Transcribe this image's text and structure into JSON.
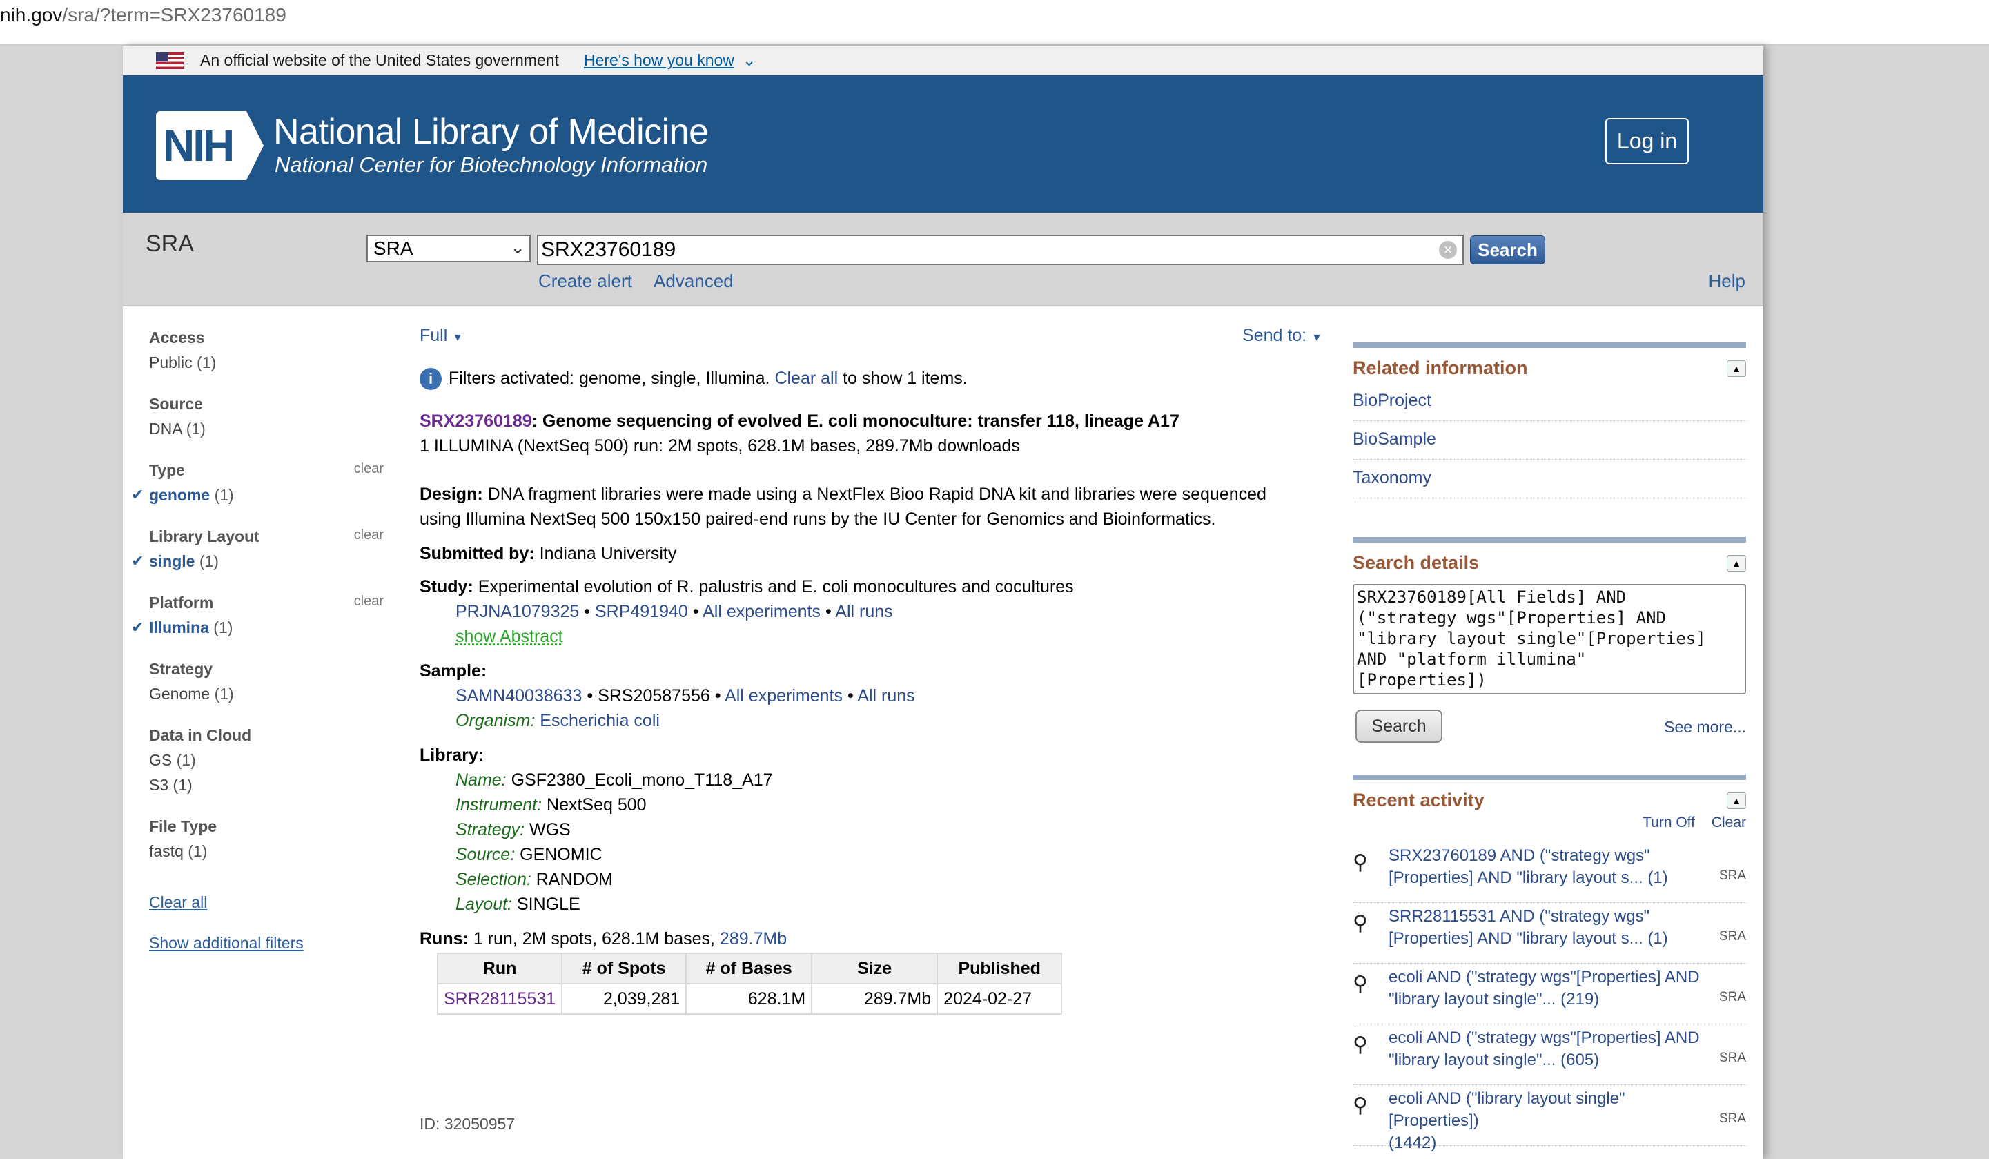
{
  "browser": {
    "url_host": "nih.gov",
    "url_path": "/sra/?term=SRX23760189"
  },
  "gov_banner": {
    "text": "An official website of the United States government",
    "link": "Here's how you know",
    "chevron": "⌄"
  },
  "header": {
    "logo_text": "NIH",
    "title": "National Library of Medicine",
    "subtitle": "National Center for Biotechnology Information",
    "login": "Log in"
  },
  "search": {
    "db_label": "SRA",
    "db_selected": "SRA",
    "term": "SRX23760189",
    "search_label": "Search",
    "create_alert": "Create alert",
    "advanced": "Advanced",
    "help": "Help"
  },
  "filters": {
    "access": {
      "title": "Access",
      "item": "Public",
      "count": "(1)"
    },
    "source": {
      "title": "Source",
      "item": "DNA",
      "count": "(1)"
    },
    "type": {
      "title": "Type",
      "clear": "clear",
      "item": "genome",
      "count": "(1)"
    },
    "layout": {
      "title": "Library Layout",
      "clear": "clear",
      "item": "single",
      "count": "(1)"
    },
    "platform": {
      "title": "Platform",
      "clear": "clear",
      "item": "Illumina",
      "count": "(1)"
    },
    "strategy": {
      "title": "Strategy",
      "item": "Genome",
      "count": "(1)"
    },
    "cloud": {
      "title": "Data in Cloud",
      "item1": "GS",
      "count1": "(1)",
      "item2": "S3",
      "count2": "(1)"
    },
    "filetype": {
      "title": "File Type",
      "item": "fastq",
      "count": "(1)"
    },
    "clear_all": "Clear all",
    "show_additional": "Show additional filters"
  },
  "main": {
    "format": "Full",
    "send_to": "Send to:",
    "filters_msg_pre": "Filters activated: genome, single, Illumina.",
    "filters_clear": "Clear all",
    "filters_msg_post": "to show 1 items.",
    "accession": "SRX23760189",
    "title": ": Genome sequencing of evolved E. coli monoculture: transfer 118, lineage A17",
    "summary": "1 ILLUMINA (NextSeq 500) run: 2M spots, 628.1M bases, 289.7Mb downloads",
    "design_label": "Design:",
    "design_line1": "DNA fragment libraries were made using a NextFlex Bioo Rapid DNA kit and libraries were sequenced",
    "design_line2": "using Illumina NextSeq 500 150x150 paired-end runs by the IU Center for Genomics and Bioinformatics.",
    "submitted_label": "Submitted by:",
    "submitted": "Indiana University",
    "study_label": "Study:",
    "study": "Experimental evolution of R. palustris and E. coli monocultures and cocultures",
    "study_links": {
      "bioproject": "PRJNA1079325",
      "srp": "SRP491940",
      "exps": "All experiments",
      "runs": "All runs",
      "sep": "•"
    },
    "show_abstract": "show Abstract",
    "sample_label": "Sample:",
    "sample_links": {
      "samn": "SAMN40038633",
      "srs": "SRS20587556",
      "exps": "All experiments",
      "runs": "All runs"
    },
    "organism_label": "Organism:",
    "organism": "Escherichia coli",
    "library_label": "Library:",
    "lib": {
      "name_label": "Name:",
      "name": "GSF2380_Ecoli_mono_T118_A17",
      "instrument_label": "Instrument:",
      "instrument": "NextSeq 500",
      "strategy_label": "Strategy:",
      "strategy": "WGS",
      "source_label": "Source:",
      "source": "GENOMIC",
      "selection_label": "Selection:",
      "selection": "RANDOM",
      "layout_label": "Layout:",
      "layout": "SINGLE"
    },
    "runs_label": "Runs:",
    "runs_text": "1 run, 2M spots, 628.1M bases,",
    "runs_link": "289.7Mb",
    "table": {
      "headers": [
        "Run",
        "# of Spots",
        "# of Bases",
        "Size",
        "Published"
      ],
      "row": [
        "SRR28115531",
        "2,039,281",
        "628.1M",
        "289.7Mb",
        "2024-02-27"
      ]
    },
    "id": "ID: 32050957"
  },
  "sidebar": {
    "related": {
      "title": "Related information",
      "links": [
        "BioProject",
        "BioSample",
        "Taxonomy"
      ]
    },
    "details": {
      "title": "Search details",
      "lines": [
        "SRX23760189[All Fields] AND",
        "(\"strategy wgs\"[Properties] AND",
        "\"library layout single\"[Properties]",
        "AND \"platform illumina\"",
        "[Properties])"
      ],
      "search": "Search",
      "see_more": "See more..."
    },
    "recent": {
      "title": "Recent activity",
      "turn_off": "Turn Off",
      "clear": "Clear",
      "items": [
        {
          "l1": "SRX23760189 AND (\"strategy wgs\"",
          "l2": "[Properties] AND \"library layout s... (1)",
          "db": "SRA"
        },
        {
          "l1": "SRR28115531 AND (\"strategy wgs\"",
          "l2": "[Properties] AND \"library layout s... (1)",
          "db": "SRA"
        },
        {
          "l1": "ecoli AND (\"strategy wgs\"[Properties] AND",
          "l2": "\"library layout single\"... (219)",
          "db": "SRA"
        },
        {
          "l1": "ecoli AND (\"strategy wgs\"[Properties] AND",
          "l2": "\"library layout single\"... (605)",
          "db": "SRA"
        },
        {
          "l1": "ecoli AND (\"library layout single\"[Properties])",
          "l2": "(1442)",
          "db": "SRA"
        }
      ]
    }
  },
  "colors": {
    "header": "#20558a",
    "section_title": "#985735",
    "link": "#2c4c8c"
  }
}
